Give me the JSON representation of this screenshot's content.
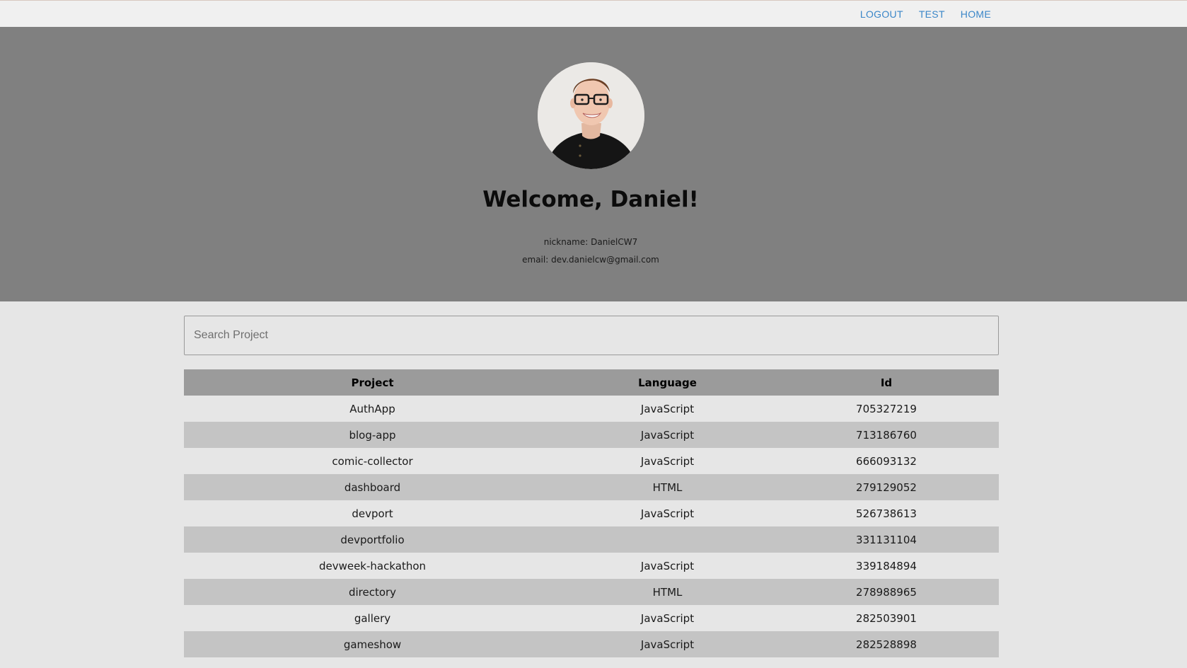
{
  "nav": {
    "logout_label": "LOGOUT",
    "test_label": "TEST",
    "home_label": "HOME",
    "link_color": "#3a86c8"
  },
  "profile": {
    "welcome": "Welcome, Daniel!",
    "nickname_line": "nickname: DanielCW7",
    "email_line": "email: dev.danielcw@gmail.com"
  },
  "search": {
    "placeholder": "Search Project",
    "value": ""
  },
  "table": {
    "headers": [
      "Project",
      "Language",
      "Id"
    ],
    "rows": [
      {
        "project": "AuthApp",
        "language": "JavaScript",
        "id": "705327219"
      },
      {
        "project": "blog-app",
        "language": "JavaScript",
        "id": "713186760"
      },
      {
        "project": "comic-collector",
        "language": "JavaScript",
        "id": "666093132"
      },
      {
        "project": "dashboard",
        "language": "HTML",
        "id": "279129052"
      },
      {
        "project": "devport",
        "language": "JavaScript",
        "id": "526738613"
      },
      {
        "project": "devportfolio",
        "language": "",
        "id": "331131104"
      },
      {
        "project": "devweek-hackathon",
        "language": "JavaScript",
        "id": "339184894"
      },
      {
        "project": "directory",
        "language": "HTML",
        "id": "278988965"
      },
      {
        "project": "gallery",
        "language": "JavaScript",
        "id": "282503901"
      },
      {
        "project": "gameshow",
        "language": "JavaScript",
        "id": "282528898"
      }
    ]
  }
}
